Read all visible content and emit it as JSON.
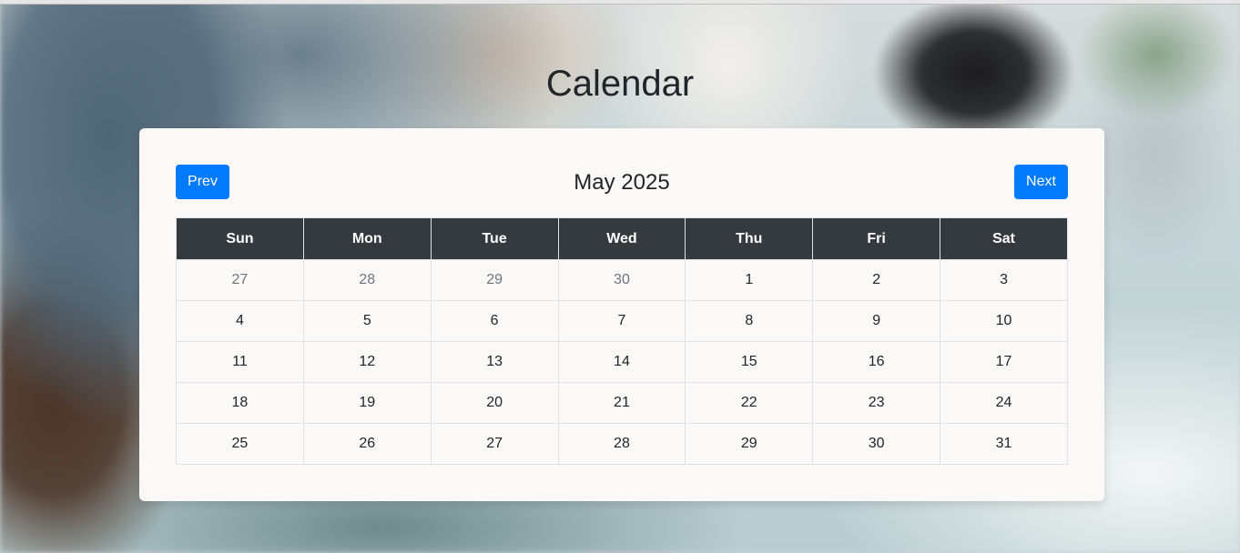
{
  "page": {
    "title": "Calendar"
  },
  "calendar": {
    "month_label": "May 2025",
    "prev_label": "Prev",
    "next_label": "Next",
    "weekdays": [
      "Sun",
      "Mon",
      "Tue",
      "Wed",
      "Thu",
      "Fri",
      "Sat"
    ],
    "weeks": [
      [
        {
          "day": "27",
          "other_month": true
        },
        {
          "day": "28",
          "other_month": true
        },
        {
          "day": "29",
          "other_month": true
        },
        {
          "day": "30",
          "other_month": true
        },
        {
          "day": "1",
          "other_month": false
        },
        {
          "day": "2",
          "other_month": false
        },
        {
          "day": "3",
          "other_month": false
        }
      ],
      [
        {
          "day": "4",
          "other_month": false
        },
        {
          "day": "5",
          "other_month": false
        },
        {
          "day": "6",
          "other_month": false
        },
        {
          "day": "7",
          "other_month": false
        },
        {
          "day": "8",
          "other_month": false
        },
        {
          "day": "9",
          "other_month": false
        },
        {
          "day": "10",
          "other_month": false
        }
      ],
      [
        {
          "day": "11",
          "other_month": false
        },
        {
          "day": "12",
          "other_month": false
        },
        {
          "day": "13",
          "other_month": false
        },
        {
          "day": "14",
          "other_month": false
        },
        {
          "day": "15",
          "other_month": false
        },
        {
          "day": "16",
          "other_month": false
        },
        {
          "day": "17",
          "other_month": false
        }
      ],
      [
        {
          "day": "18",
          "other_month": false
        },
        {
          "day": "19",
          "other_month": false
        },
        {
          "day": "20",
          "other_month": false
        },
        {
          "day": "21",
          "other_month": false
        },
        {
          "day": "22",
          "other_month": false
        },
        {
          "day": "23",
          "other_month": false
        },
        {
          "day": "24",
          "other_month": false
        }
      ],
      [
        {
          "day": "25",
          "other_month": false
        },
        {
          "day": "26",
          "other_month": false
        },
        {
          "day": "27",
          "other_month": false
        },
        {
          "day": "28",
          "other_month": false
        },
        {
          "day": "29",
          "other_month": false
        },
        {
          "day": "30",
          "other_month": false
        },
        {
          "day": "31",
          "other_month": false
        }
      ]
    ]
  },
  "colors": {
    "primary_button": "#007bff",
    "header_row": "#343a40",
    "card_background": "#fbf8f8",
    "other_month_text": "#6c757d"
  }
}
